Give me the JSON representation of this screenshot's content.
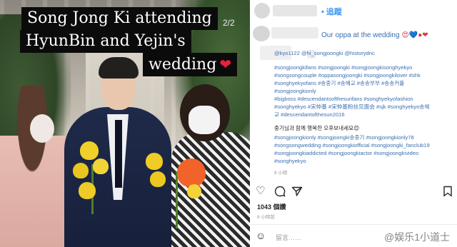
{
  "photo": {
    "caption_line1": "Song Jong Ki attending",
    "caption_line2": "HyunBin and Yejin's",
    "caption_line3": "wedding",
    "caption_heart": "❤",
    "page_indicator": "2/2"
  },
  "post": {
    "follow_label": "• 追蹤",
    "caption": "Our oppa at the wedding",
    "caption_emojis": "😍💙●❤",
    "lines": [
      "@kyo1122 @hi_songjoongki @historydnc",
      "#songjoongkifans #songjoongki #songjoongkisonghyekyo",
      "#songsongcouple #oppasongjoongki #songjoongkilover #shk",
      "#songhyekyofans #송중기 #송혜교 #송송부부 #송송커플",
      "#songjoongkionly",
      "#bigboss #descendantsofthesunfans #songhyekyofashion",
      "#songhyekyo #宋仲基 #宋仲基粉丝见面会 #sjk #songhyekyo송혜",
      "교 #descendantofthesun2016"
    ],
    "korean_line": "중기님과 함께 행복한 오후보내세요😊",
    "tag_lines": [
      "#songjoongkionly #songjoongki송중기 #songjoongkionly78",
      "#songsongwedding #songjoongkiofficial #songjoongki_fanclub19",
      "#songjoongkiaddicted #songjoongkiactor #songjoongkivideo",
      "#songhyekyo"
    ],
    "time_caption": "8 小時",
    "likes": "1043 個讚",
    "time_post": "8 小時前",
    "comment_placeholder": "留言……",
    "watermark": "@娱乐1小道士"
  },
  "icons": {
    "heart": "heart-icon",
    "comment": "comment-icon",
    "share": "share-icon",
    "save": "bookmark-icon",
    "emoji": "smile-icon"
  }
}
